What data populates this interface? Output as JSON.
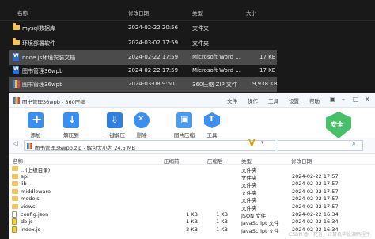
{
  "explorer": {
    "columns": {
      "name": "名称",
      "date": "修改日期",
      "type": "类型",
      "size": "大小"
    },
    "rows": [
      {
        "name": "mysql数据库",
        "date": "2024-02-22 20:56",
        "type": "文件夹",
        "size": "",
        "icon": "folder-icon"
      },
      {
        "name": "环境部署软件",
        "date": "2024-03-02 17:59",
        "type": "文件夹",
        "size": "",
        "icon": "folder-icon"
      },
      {
        "name": "node.js环境安装文档",
        "date": "2024-02-22 17:59",
        "type": "Microsoft Word ...",
        "size": "17 KB",
        "icon": "word-doc-icon",
        "selected": true
      },
      {
        "name": "图书管理36wpb",
        "date": "2024-02-22 17:59",
        "type": "Microsoft Word ...",
        "size": "17 KB",
        "icon": "word-doc-icon"
      },
      {
        "name": "图书管理36wpb",
        "date": "2024-03-08 9:50",
        "type": "360压缩 ZIP 文件",
        "size": "9,938 KB",
        "icon": "zip-icon",
        "selected": true
      }
    ]
  },
  "zip": {
    "title": "图书管理36wpb - 360压缩",
    "menu": {
      "file": "文件",
      "ops": "操作",
      "tools": "工具",
      "settings": "设置",
      "help": "帮助"
    },
    "toolbar": {
      "add": "添加",
      "extract": "解压到",
      "one_click": "一键解压",
      "delete": "删除",
      "image": "图片压缩",
      "tools": "工具",
      "safe": "安全"
    },
    "address": "图书管理36wpb.zip - 解包大小为 24.5 MB",
    "columns": {
      "name": "名称",
      "compressed": "压缩前",
      "size": "压缩后",
      "type": "类型",
      "modified": "修改日期"
    },
    "rows": [
      {
        "name": ".. (上级目录)",
        "compressed": "",
        "size": "",
        "type": "文件夹",
        "modified": "",
        "kind": "up"
      },
      {
        "name": "api",
        "compressed": "",
        "size": "",
        "type": "文件夹",
        "modified": "2024-02-22 17:57",
        "kind": "folder"
      },
      {
        "name": "lib",
        "compressed": "",
        "size": "",
        "type": "文件夹",
        "modified": "2024-02-22 17:57",
        "kind": "folder"
      },
      {
        "name": "middleware",
        "compressed": "",
        "size": "",
        "type": "文件夹",
        "modified": "2024-02-22 17:57",
        "kind": "folder"
      },
      {
        "name": "models",
        "compressed": "",
        "size": "",
        "type": "文件夹",
        "modified": "2024-02-22 17:57",
        "kind": "folder"
      },
      {
        "name": "views",
        "compressed": "",
        "size": "",
        "type": "文件夹",
        "modified": "2024-02-22 17:57",
        "kind": "folder"
      },
      {
        "name": "config.json",
        "compressed": "1 KB",
        "size": "1 KB",
        "type": "JSON 文件",
        "modified": "2024-02-22 16:34",
        "kind": "file"
      },
      {
        "name": "db.js",
        "compressed": "1 KB",
        "size": "1 KB",
        "type": "JavaScript 文件",
        "modified": "2024-02-22 16:34",
        "kind": "js"
      },
      {
        "name": "index.js",
        "compressed": "2 KB",
        "size": "1 KB",
        "type": "JavaScript 文件",
        "modified": "2024-02-22 16:34",
        "kind": "js"
      }
    ]
  },
  "watermark": "CSDN @「花音」计算机毕设源码程序"
}
